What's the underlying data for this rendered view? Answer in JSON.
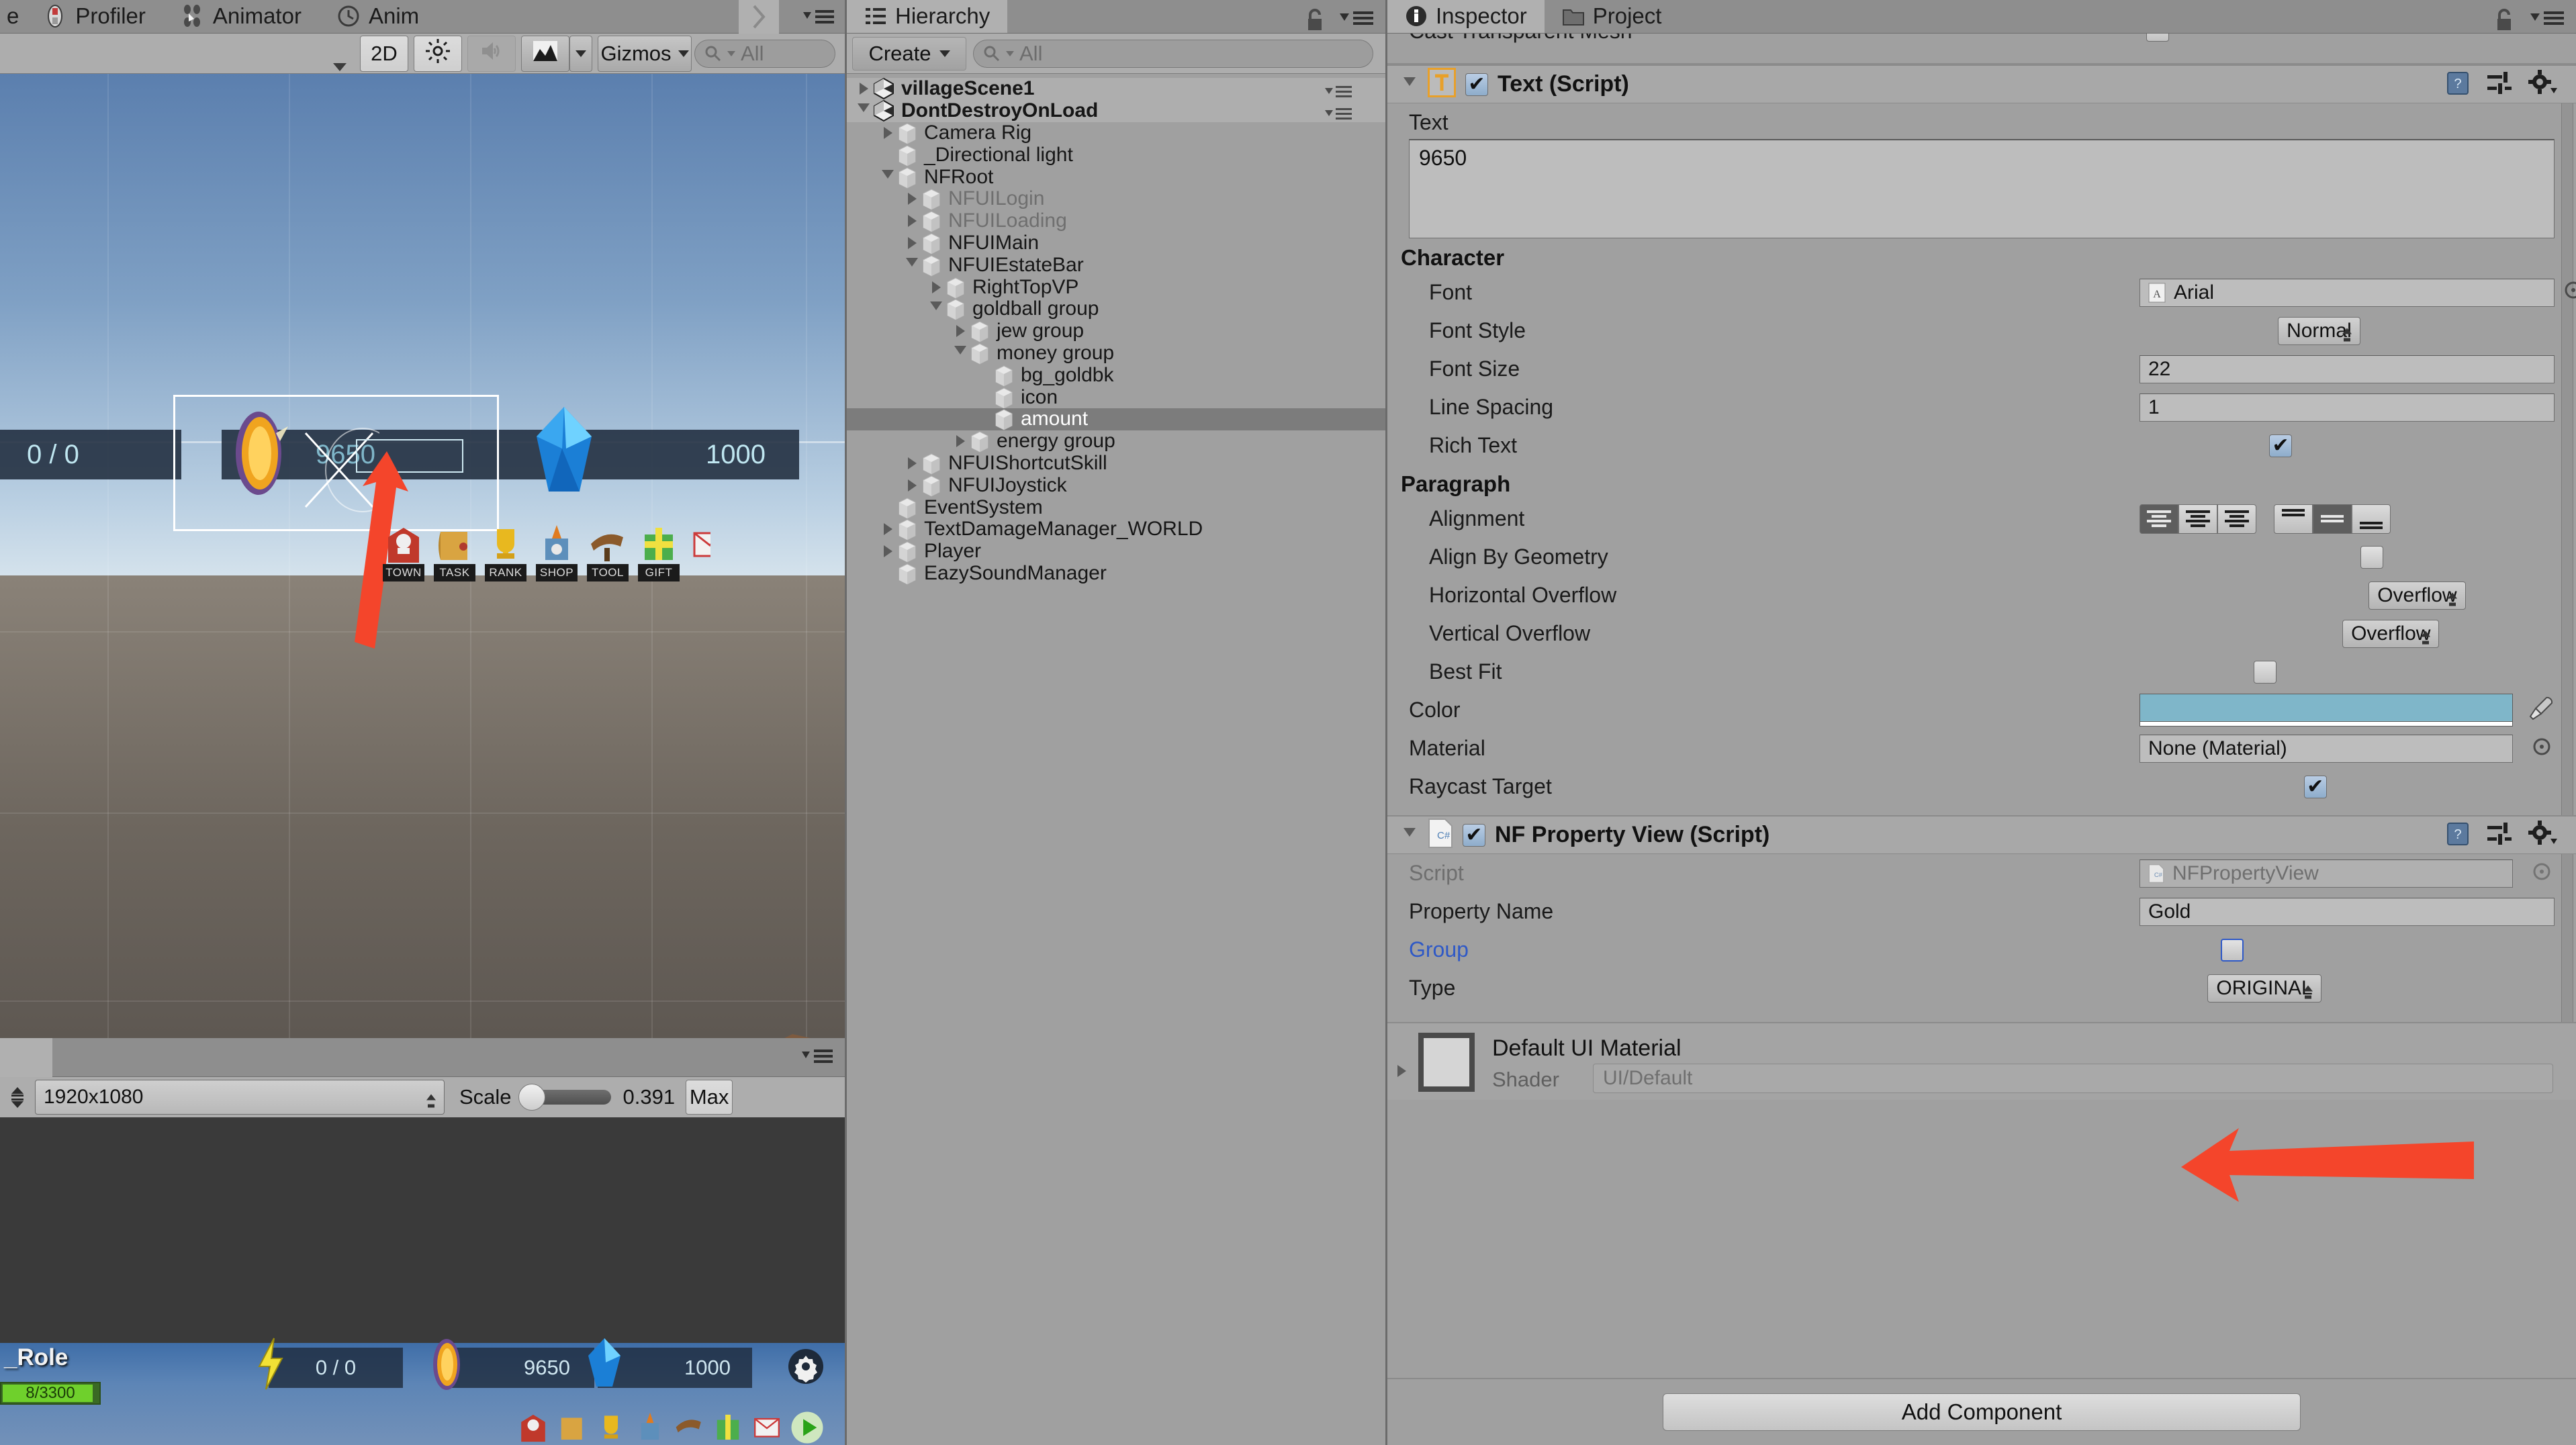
{
  "sceneview": {
    "tabs": [
      {
        "label": "e",
        "icon": "partial-tab"
      },
      {
        "label": "Profiler",
        "icon": "profiler-icon"
      },
      {
        "label": "Animator",
        "icon": "animator-icon"
      },
      {
        "label": "Anim",
        "icon": "animation-icon"
      }
    ],
    "toolbar": {
      "draw_mode_label": "",
      "twod_label": "2D",
      "lighting_icon": "sun-icon",
      "audio_icon": "speaker-icon",
      "fx_icon": "image-effects-icon",
      "gizmos_label": "Gizmos",
      "search_placeholder": "All",
      "search_value": ""
    },
    "game_hud": {
      "energy_value": "0 / 0",
      "gold_value": "9650",
      "gem_value": "1000",
      "nav_buttons": [
        "TOWN",
        "TASK",
        "RANK",
        "SHOP",
        "TOOL",
        "GIFT"
      ]
    },
    "bottom_toolbar": {
      "resolution": "1920x1080",
      "scale_label": "Scale",
      "scale_value": "0.391",
      "maximize_label": "Max"
    },
    "preview_hud": {
      "role_label": "_Role",
      "hp_value": "8/3300",
      "energy_value": "0 / 0",
      "gold_value": "9650",
      "gem_value": "1000"
    }
  },
  "hierarchy": {
    "tab_label": "Hierarchy",
    "tab_icon": "hierarchy-icon",
    "lock_icon": "lock-icon",
    "menu_icon": "hamburger-menu-icon",
    "create_label": "Create",
    "search_placeholder": "All",
    "search_value": "",
    "items": [
      {
        "label": "villageScene1",
        "depth": 0,
        "arrow": "closed",
        "type": "scene",
        "state": "normal"
      },
      {
        "label": "DontDestroyOnLoad",
        "depth": 0,
        "arrow": "open",
        "type": "scene",
        "state": "normal"
      },
      {
        "label": "Camera Rig",
        "depth": 1,
        "arrow": "closed",
        "type": "go",
        "state": "normal"
      },
      {
        "label": "_Directional light",
        "depth": 1,
        "arrow": "none",
        "type": "go",
        "state": "normal"
      },
      {
        "label": "NFRoot",
        "depth": 1,
        "arrow": "open",
        "type": "go",
        "state": "normal"
      },
      {
        "label": "NFUILogin",
        "depth": 2,
        "arrow": "closed",
        "type": "go",
        "state": "inactive"
      },
      {
        "label": "NFUILoading",
        "depth": 2,
        "arrow": "closed",
        "type": "go",
        "state": "inactive"
      },
      {
        "label": "NFUIMain",
        "depth": 2,
        "arrow": "closed",
        "type": "go",
        "state": "normal"
      },
      {
        "label": "NFUIEstateBar",
        "depth": 2,
        "arrow": "open",
        "type": "go",
        "state": "normal"
      },
      {
        "label": "RightTopVP",
        "depth": 3,
        "arrow": "closed",
        "type": "go",
        "state": "normal"
      },
      {
        "label": "goldball group",
        "depth": 3,
        "arrow": "open",
        "type": "go",
        "state": "normal"
      },
      {
        "label": "jew group",
        "depth": 4,
        "arrow": "closed",
        "type": "go",
        "state": "normal"
      },
      {
        "label": "money group",
        "depth": 4,
        "arrow": "open",
        "type": "go",
        "state": "normal"
      },
      {
        "label": "bg_goldbk",
        "depth": 5,
        "arrow": "none",
        "type": "go",
        "state": "normal"
      },
      {
        "label": "icon",
        "depth": 5,
        "arrow": "none",
        "type": "go",
        "state": "normal"
      },
      {
        "label": "amount",
        "depth": 5,
        "arrow": "none",
        "type": "go",
        "state": "selected"
      },
      {
        "label": "energy group",
        "depth": 4,
        "arrow": "closed",
        "type": "go",
        "state": "normal"
      },
      {
        "label": "NFUIShortcutSkill",
        "depth": 2,
        "arrow": "closed",
        "type": "go",
        "state": "normal"
      },
      {
        "label": "NFUIJoystick",
        "depth": 2,
        "arrow": "closed",
        "type": "go",
        "state": "normal"
      },
      {
        "label": "EventSystem",
        "depth": 1,
        "arrow": "none",
        "type": "go",
        "state": "normal"
      },
      {
        "label": "TextDamageManager_WORLD",
        "depth": 1,
        "arrow": "closed",
        "type": "go",
        "state": "normal"
      },
      {
        "label": "Player",
        "depth": 1,
        "arrow": "closed",
        "type": "go",
        "state": "normal"
      },
      {
        "label": "EazySoundManager",
        "depth": 1,
        "arrow": "none",
        "type": "go",
        "state": "normal"
      }
    ]
  },
  "inspector": {
    "tabs": [
      {
        "label": "Inspector",
        "icon": "info-icon",
        "active": true
      },
      {
        "label": "Project",
        "icon": "project-icon",
        "active": false
      }
    ],
    "lock_icon": "lock-icon",
    "menu_icon": "hamburger-menu-icon",
    "clipped_top_row": {
      "label": "Cast Transparent Mesh",
      "checked": false
    },
    "text_component": {
      "title": "Text (Script)",
      "icon": "text-script-icon",
      "enabled": true,
      "help_icon": "help-book-icon",
      "preset_icon": "preset-icon",
      "gear_icon": "gear-icon",
      "text_label": "Text",
      "text_value": "9650",
      "character_header": "Character",
      "font_label": "Font",
      "font_value": "Arial",
      "font_icon": "font-asset-icon",
      "font_style_label": "Font Style",
      "font_style_value": "Normal",
      "font_size_label": "Font Size",
      "font_size_value": "22",
      "line_spacing_label": "Line Spacing",
      "line_spacing_value": "1",
      "rich_text_label": "Rich Text",
      "rich_text_checked": true,
      "paragraph_header": "Paragraph",
      "alignment_label": "Alignment",
      "alignment_horizontal": "left",
      "alignment_vertical": "middle",
      "align_geometry_label": "Align By Geometry",
      "align_geometry_checked": false,
      "h_overflow_label": "Horizontal Overflow",
      "h_overflow_value": "Overflow",
      "v_overflow_label": "Vertical Overflow",
      "v_overflow_value": "Overflow",
      "best_fit_label": "Best Fit",
      "best_fit_checked": false,
      "color_label": "Color",
      "color_value": "#7fb6c9",
      "color_picker_icon": "eyedropper-icon",
      "material_label": "Material",
      "material_value": "None (Material)",
      "raycast_label": "Raycast Target",
      "raycast_checked": true
    },
    "property_view_component": {
      "title": "NF Property View (Script)",
      "icon": "csharp-script-icon",
      "enabled": true,
      "help_icon": "help-book-icon",
      "preset_icon": "preset-icon",
      "gear_icon": "gear-icon",
      "script_label": "Script",
      "script_value": "NFPropertyView",
      "property_name_label": "Property Name",
      "property_name_value": "Gold",
      "group_label": "Group",
      "group_checked": false,
      "type_label": "Type",
      "type_value": "ORIGINAL"
    },
    "material_section": {
      "title": "Default UI Material",
      "shader_label": "Shader",
      "shader_value": "UI/Default"
    },
    "add_component_label": "Add Component"
  },
  "annotations": {
    "arrow_color": "#f4452b",
    "arrow_game_target": "gold amount text in game view",
    "arrow_inspector_target": "Property Name field value Gold"
  }
}
